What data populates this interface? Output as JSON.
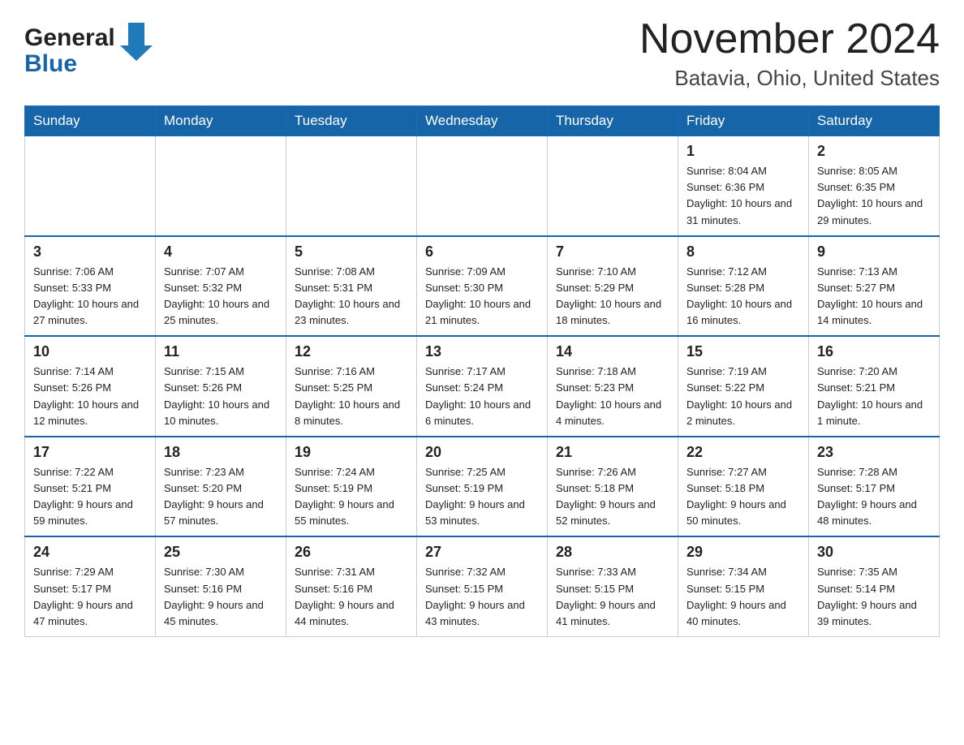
{
  "header": {
    "logo_general": "General",
    "logo_blue": "Blue",
    "title": "November 2024",
    "subtitle": "Batavia, Ohio, United States"
  },
  "weekdays": [
    "Sunday",
    "Monday",
    "Tuesday",
    "Wednesday",
    "Thursday",
    "Friday",
    "Saturday"
  ],
  "weeks": [
    [
      {
        "day": "",
        "sunrise": "",
        "sunset": "",
        "daylight": ""
      },
      {
        "day": "",
        "sunrise": "",
        "sunset": "",
        "daylight": ""
      },
      {
        "day": "",
        "sunrise": "",
        "sunset": "",
        "daylight": ""
      },
      {
        "day": "",
        "sunrise": "",
        "sunset": "",
        "daylight": ""
      },
      {
        "day": "",
        "sunrise": "",
        "sunset": "",
        "daylight": ""
      },
      {
        "day": "1",
        "sunrise": "Sunrise: 8:04 AM",
        "sunset": "Sunset: 6:36 PM",
        "daylight": "Daylight: 10 hours and 31 minutes."
      },
      {
        "day": "2",
        "sunrise": "Sunrise: 8:05 AM",
        "sunset": "Sunset: 6:35 PM",
        "daylight": "Daylight: 10 hours and 29 minutes."
      }
    ],
    [
      {
        "day": "3",
        "sunrise": "Sunrise: 7:06 AM",
        "sunset": "Sunset: 5:33 PM",
        "daylight": "Daylight: 10 hours and 27 minutes."
      },
      {
        "day": "4",
        "sunrise": "Sunrise: 7:07 AM",
        "sunset": "Sunset: 5:32 PM",
        "daylight": "Daylight: 10 hours and 25 minutes."
      },
      {
        "day": "5",
        "sunrise": "Sunrise: 7:08 AM",
        "sunset": "Sunset: 5:31 PM",
        "daylight": "Daylight: 10 hours and 23 minutes."
      },
      {
        "day": "6",
        "sunrise": "Sunrise: 7:09 AM",
        "sunset": "Sunset: 5:30 PM",
        "daylight": "Daylight: 10 hours and 21 minutes."
      },
      {
        "day": "7",
        "sunrise": "Sunrise: 7:10 AM",
        "sunset": "Sunset: 5:29 PM",
        "daylight": "Daylight: 10 hours and 18 minutes."
      },
      {
        "day": "8",
        "sunrise": "Sunrise: 7:12 AM",
        "sunset": "Sunset: 5:28 PM",
        "daylight": "Daylight: 10 hours and 16 minutes."
      },
      {
        "day": "9",
        "sunrise": "Sunrise: 7:13 AM",
        "sunset": "Sunset: 5:27 PM",
        "daylight": "Daylight: 10 hours and 14 minutes."
      }
    ],
    [
      {
        "day": "10",
        "sunrise": "Sunrise: 7:14 AM",
        "sunset": "Sunset: 5:26 PM",
        "daylight": "Daylight: 10 hours and 12 minutes."
      },
      {
        "day": "11",
        "sunrise": "Sunrise: 7:15 AM",
        "sunset": "Sunset: 5:26 PM",
        "daylight": "Daylight: 10 hours and 10 minutes."
      },
      {
        "day": "12",
        "sunrise": "Sunrise: 7:16 AM",
        "sunset": "Sunset: 5:25 PM",
        "daylight": "Daylight: 10 hours and 8 minutes."
      },
      {
        "day": "13",
        "sunrise": "Sunrise: 7:17 AM",
        "sunset": "Sunset: 5:24 PM",
        "daylight": "Daylight: 10 hours and 6 minutes."
      },
      {
        "day": "14",
        "sunrise": "Sunrise: 7:18 AM",
        "sunset": "Sunset: 5:23 PM",
        "daylight": "Daylight: 10 hours and 4 minutes."
      },
      {
        "day": "15",
        "sunrise": "Sunrise: 7:19 AM",
        "sunset": "Sunset: 5:22 PM",
        "daylight": "Daylight: 10 hours and 2 minutes."
      },
      {
        "day": "16",
        "sunrise": "Sunrise: 7:20 AM",
        "sunset": "Sunset: 5:21 PM",
        "daylight": "Daylight: 10 hours and 1 minute."
      }
    ],
    [
      {
        "day": "17",
        "sunrise": "Sunrise: 7:22 AM",
        "sunset": "Sunset: 5:21 PM",
        "daylight": "Daylight: 9 hours and 59 minutes."
      },
      {
        "day": "18",
        "sunrise": "Sunrise: 7:23 AM",
        "sunset": "Sunset: 5:20 PM",
        "daylight": "Daylight: 9 hours and 57 minutes."
      },
      {
        "day": "19",
        "sunrise": "Sunrise: 7:24 AM",
        "sunset": "Sunset: 5:19 PM",
        "daylight": "Daylight: 9 hours and 55 minutes."
      },
      {
        "day": "20",
        "sunrise": "Sunrise: 7:25 AM",
        "sunset": "Sunset: 5:19 PM",
        "daylight": "Daylight: 9 hours and 53 minutes."
      },
      {
        "day": "21",
        "sunrise": "Sunrise: 7:26 AM",
        "sunset": "Sunset: 5:18 PM",
        "daylight": "Daylight: 9 hours and 52 minutes."
      },
      {
        "day": "22",
        "sunrise": "Sunrise: 7:27 AM",
        "sunset": "Sunset: 5:18 PM",
        "daylight": "Daylight: 9 hours and 50 minutes."
      },
      {
        "day": "23",
        "sunrise": "Sunrise: 7:28 AM",
        "sunset": "Sunset: 5:17 PM",
        "daylight": "Daylight: 9 hours and 48 minutes."
      }
    ],
    [
      {
        "day": "24",
        "sunrise": "Sunrise: 7:29 AM",
        "sunset": "Sunset: 5:17 PM",
        "daylight": "Daylight: 9 hours and 47 minutes."
      },
      {
        "day": "25",
        "sunrise": "Sunrise: 7:30 AM",
        "sunset": "Sunset: 5:16 PM",
        "daylight": "Daylight: 9 hours and 45 minutes."
      },
      {
        "day": "26",
        "sunrise": "Sunrise: 7:31 AM",
        "sunset": "Sunset: 5:16 PM",
        "daylight": "Daylight: 9 hours and 44 minutes."
      },
      {
        "day": "27",
        "sunrise": "Sunrise: 7:32 AM",
        "sunset": "Sunset: 5:15 PM",
        "daylight": "Daylight: 9 hours and 43 minutes."
      },
      {
        "day": "28",
        "sunrise": "Sunrise: 7:33 AM",
        "sunset": "Sunset: 5:15 PM",
        "daylight": "Daylight: 9 hours and 41 minutes."
      },
      {
        "day": "29",
        "sunrise": "Sunrise: 7:34 AM",
        "sunset": "Sunset: 5:15 PM",
        "daylight": "Daylight: 9 hours and 40 minutes."
      },
      {
        "day": "30",
        "sunrise": "Sunrise: 7:35 AM",
        "sunset": "Sunset: 5:14 PM",
        "daylight": "Daylight: 9 hours and 39 minutes."
      }
    ]
  ]
}
